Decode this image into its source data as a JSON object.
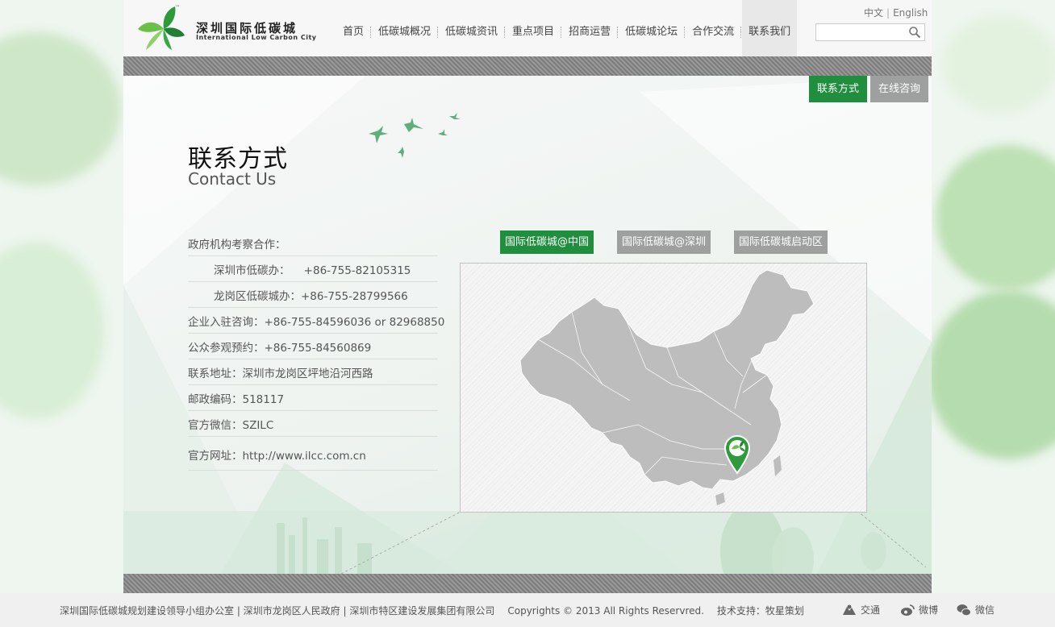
{
  "brand": {
    "name_cn": "深圳国际低碳城",
    "name_en": "International Low Carbon City",
    "tm": "™",
    "colors": {
      "green": "#1f8e3d",
      "gray_tab": "#9da09e"
    }
  },
  "nav": {
    "items": [
      {
        "label": "首页"
      },
      {
        "label": "低碳城概况"
      },
      {
        "label": "低碳城资讯"
      },
      {
        "label": "重点项目"
      },
      {
        "label": "招商运营"
      },
      {
        "label": "低碳城论坛"
      },
      {
        "label": "合作交流"
      },
      {
        "label": "联系我们",
        "active": true
      }
    ]
  },
  "lang": {
    "cn": "中文",
    "sep": "|",
    "en": "English"
  },
  "search": {
    "value": "",
    "placeholder": "",
    "icon": "search-icon"
  },
  "side_tabs": [
    {
      "label": "联系方式",
      "active": true
    },
    {
      "label": "在线咨询",
      "active": false
    }
  ],
  "heading": {
    "cn": "联系方式",
    "en": "Contact Us"
  },
  "contact": {
    "rows": [
      {
        "text": "政府机构考察合作：",
        "indent": false
      },
      {
        "text": "深圳市低碳办：    +86-755-82105315",
        "indent": true
      },
      {
        "text": "龙岗区低碳城办：+86-755-28799566",
        "indent": true
      },
      {
        "text": "企业入驻咨询：+86-755-84596036 or 82968850",
        "indent": false
      },
      {
        "text": "公众参观预约：+86-755-84560869",
        "indent": false
      },
      {
        "text": "联系地址：深圳市龙岗区坪地沿河西路",
        "indent": false
      },
      {
        "text": "邮政编码：518117",
        "indent": false
      },
      {
        "text": "官方微信：SZILC",
        "indent": false
      },
      {
        "text": "官方网址：http://www.ilcc.com.cn",
        "indent": false
      }
    ]
  },
  "region_tabs": [
    {
      "label": "国际低碳城@中国",
      "active": true
    },
    {
      "label": "国际低碳城@深圳",
      "active": false
    },
    {
      "label": "国际低碳城启动区",
      "active": false
    }
  ],
  "map": {
    "marker_icon": "map-pin-leaf-icon"
  },
  "footer": {
    "org": "深圳国际低碳城规划建设领导小组办公室 | 深圳市龙岗区人民政府 | 深圳市特区建设发展集团有限公司",
    "copyright": "Copyrights © 2013 All Rights Reservred.",
    "support": "技术支持：牧星策划",
    "social": [
      {
        "label": "交通",
        "icon": "traffic-icon"
      },
      {
        "label": "微博",
        "icon": "weibo-icon"
      },
      {
        "label": "微信",
        "icon": "wechat-icon"
      }
    ]
  }
}
